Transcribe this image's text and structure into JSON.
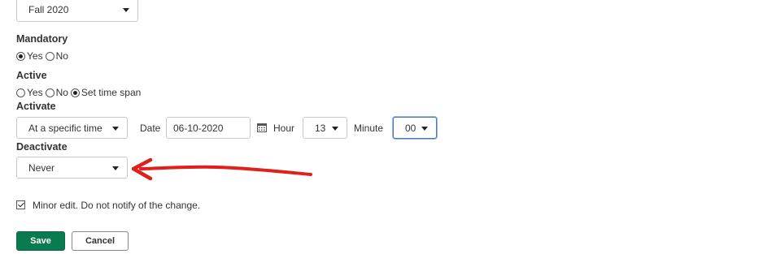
{
  "term": {
    "selected": "Fall 2020"
  },
  "mandatory": {
    "label": "Mandatory",
    "options": [
      "Yes",
      "No"
    ],
    "selected": "Yes"
  },
  "active": {
    "label": "Active",
    "options": [
      "Yes",
      "No",
      "Set time span"
    ],
    "selected": "Set time span"
  },
  "activate": {
    "label": "Activate",
    "mode": "At a specific time",
    "date_label": "Date",
    "date_value": "06-10-2020",
    "hour_label": "Hour",
    "hour_value": "13",
    "minute_label": "Minute",
    "minute_value": "00"
  },
  "deactivate": {
    "label": "Deactivate",
    "mode": "Never"
  },
  "minor_edit": {
    "label": "Minor edit. Do not notify of the change.",
    "checked": true
  },
  "actions": {
    "save_label": "Save",
    "cancel_label": "Cancel"
  },
  "colors": {
    "primary_button": "#0a7a4f",
    "annotation_arrow": "#e0201a",
    "focus_border": "#4a77b4"
  },
  "icons": {
    "calendar": "calendar-icon",
    "dropdown": "chevron-down-icon"
  }
}
